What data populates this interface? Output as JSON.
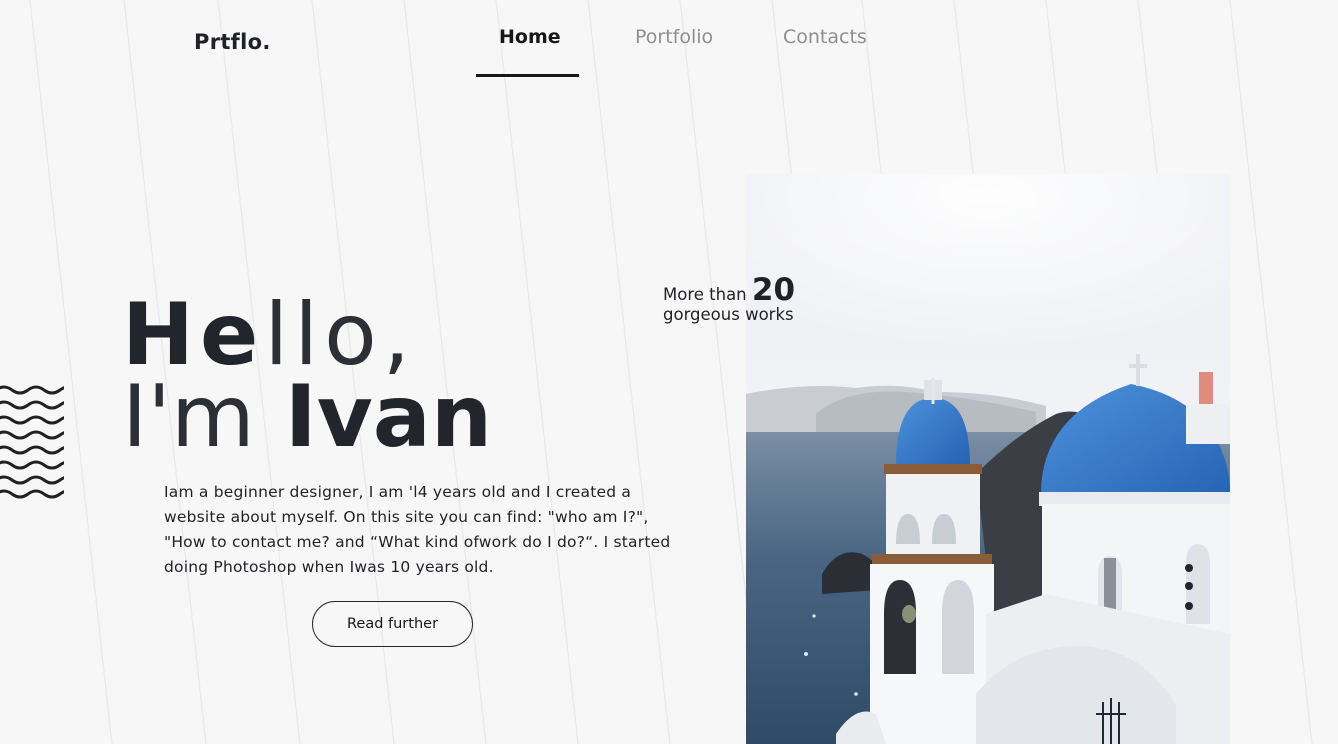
{
  "brand": {
    "logo": "Prtflo."
  },
  "nav": {
    "items": [
      {
        "label": "Home",
        "active": true
      },
      {
        "label": "Portfolio",
        "active": false
      },
      {
        "label": "Contacts",
        "active": false
      }
    ]
  },
  "hero": {
    "line1_bold": "He",
    "line1_thin": "llo,",
    "line2_thin": "I'm",
    "line2_bold": "Ivan",
    "intro": "Iam a beginner designer, I am 'l4 years old and I created a website about myself. On this site you can find: \"who am I?\", \"How to contact me? and “What kind ofwork do I do?“. I started doing Photoshop when Iwas 10 years old.",
    "button_label": "Read further"
  },
  "stats": {
    "prefix": "More than",
    "number": "20",
    "suffix": "gorgeous works"
  },
  "photo": {
    "icon": "santorini-church-photo"
  },
  "colors": {
    "background": "#f7f7f7",
    "text": "#22252b",
    "nav_inactive": "#8d8f93",
    "dome_blue": "#2f74c6",
    "sea": "#3c5a78"
  }
}
